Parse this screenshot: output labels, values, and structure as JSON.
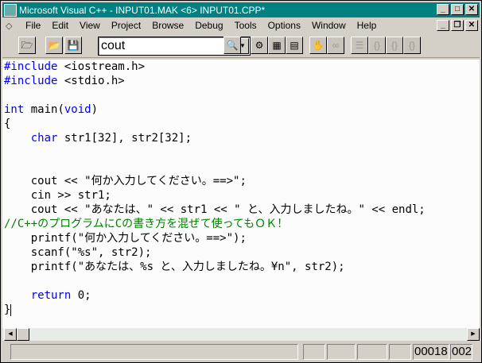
{
  "title": "Microsoft Visual C++ - INPUT01.MAK <6> INPUT01.CPP*",
  "menu": [
    "File",
    "Edit",
    "View",
    "Project",
    "Browse",
    "Debug",
    "Tools",
    "Options",
    "Window",
    "Help"
  ],
  "find_combo": {
    "value": "cout"
  },
  "toolbar_icons": [
    "open-project-icon",
    "open-file-icon",
    "save-icon",
    "find-in-files-icon",
    "compile-icon",
    "build-icon",
    "rebuild-all-icon",
    "stop-build-icon",
    "go-icon",
    "step-into-icon",
    "step-over-icon",
    "step-out-icon",
    "run-to-cursor-icon"
  ],
  "code": [
    [
      {
        "t": "#include",
        "c": "kw"
      },
      {
        "t": " <iostream.h>"
      }
    ],
    [
      {
        "t": "#include",
        "c": "kw"
      },
      {
        "t": " <stdio.h>"
      }
    ],
    [],
    [
      {
        "t": "int",
        "c": "kw"
      },
      {
        "t": " main("
      },
      {
        "t": "void",
        "c": "kw"
      },
      {
        "t": ")"
      }
    ],
    [
      {
        "t": "{"
      }
    ],
    [
      {
        "t": "    "
      },
      {
        "t": "char",
        "c": "kw"
      },
      {
        "t": " str1[32], str2[32];"
      }
    ],
    [],
    [],
    [
      {
        "t": "    cout << \"何か入力してください。==>\";"
      }
    ],
    [
      {
        "t": "    cin >> str1;"
      }
    ],
    [
      {
        "t": "    cout << \"あなたは、\" << str1 << \" と、入力しましたね。\" << endl;"
      }
    ],
    [
      {
        "t": "//C++のプログラムにCの書き方を混ぜて使ってもＯＫ！",
        "c": "cm"
      }
    ],
    [
      {
        "t": "    printf(\"何か入力してください。==>\");"
      }
    ],
    [
      {
        "t": "    scanf(\"%s\", str2);"
      }
    ],
    [
      {
        "t": "    printf(\"あなたは、%s と、入力しましたね。¥n\", str2);"
      }
    ],
    [],
    [
      {
        "t": "    "
      },
      {
        "t": "return",
        "c": "kw"
      },
      {
        "t": " 0;"
      }
    ],
    [
      {
        "t": "}"
      }
    ]
  ],
  "status": {
    "line": "00018",
    "col": "002"
  }
}
